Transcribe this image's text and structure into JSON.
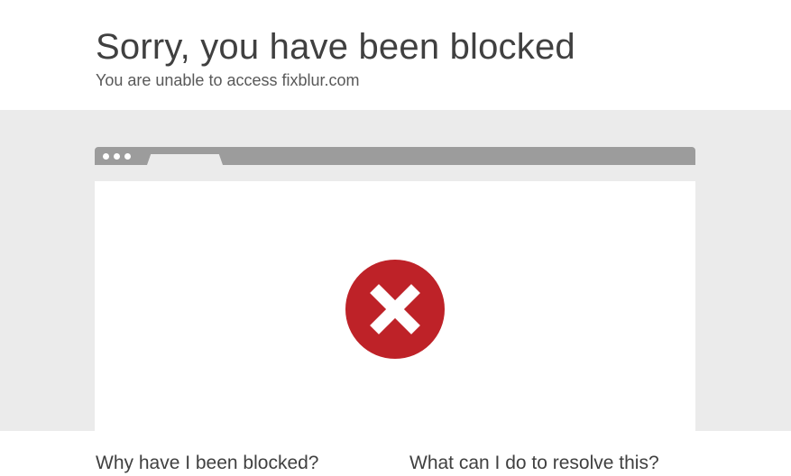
{
  "header": {
    "title": "Sorry, you have been blocked",
    "subtitle": "You are unable to access fixblur.com"
  },
  "illustration": {
    "icon": "error-x-circle-icon",
    "icon_color": "#be2228",
    "bar_color": "#9c9c9c",
    "band_color": "#ebebeb"
  },
  "sections": {
    "why_heading": "Why have I been blocked?",
    "resolve_heading": "What can I do to resolve this?"
  }
}
